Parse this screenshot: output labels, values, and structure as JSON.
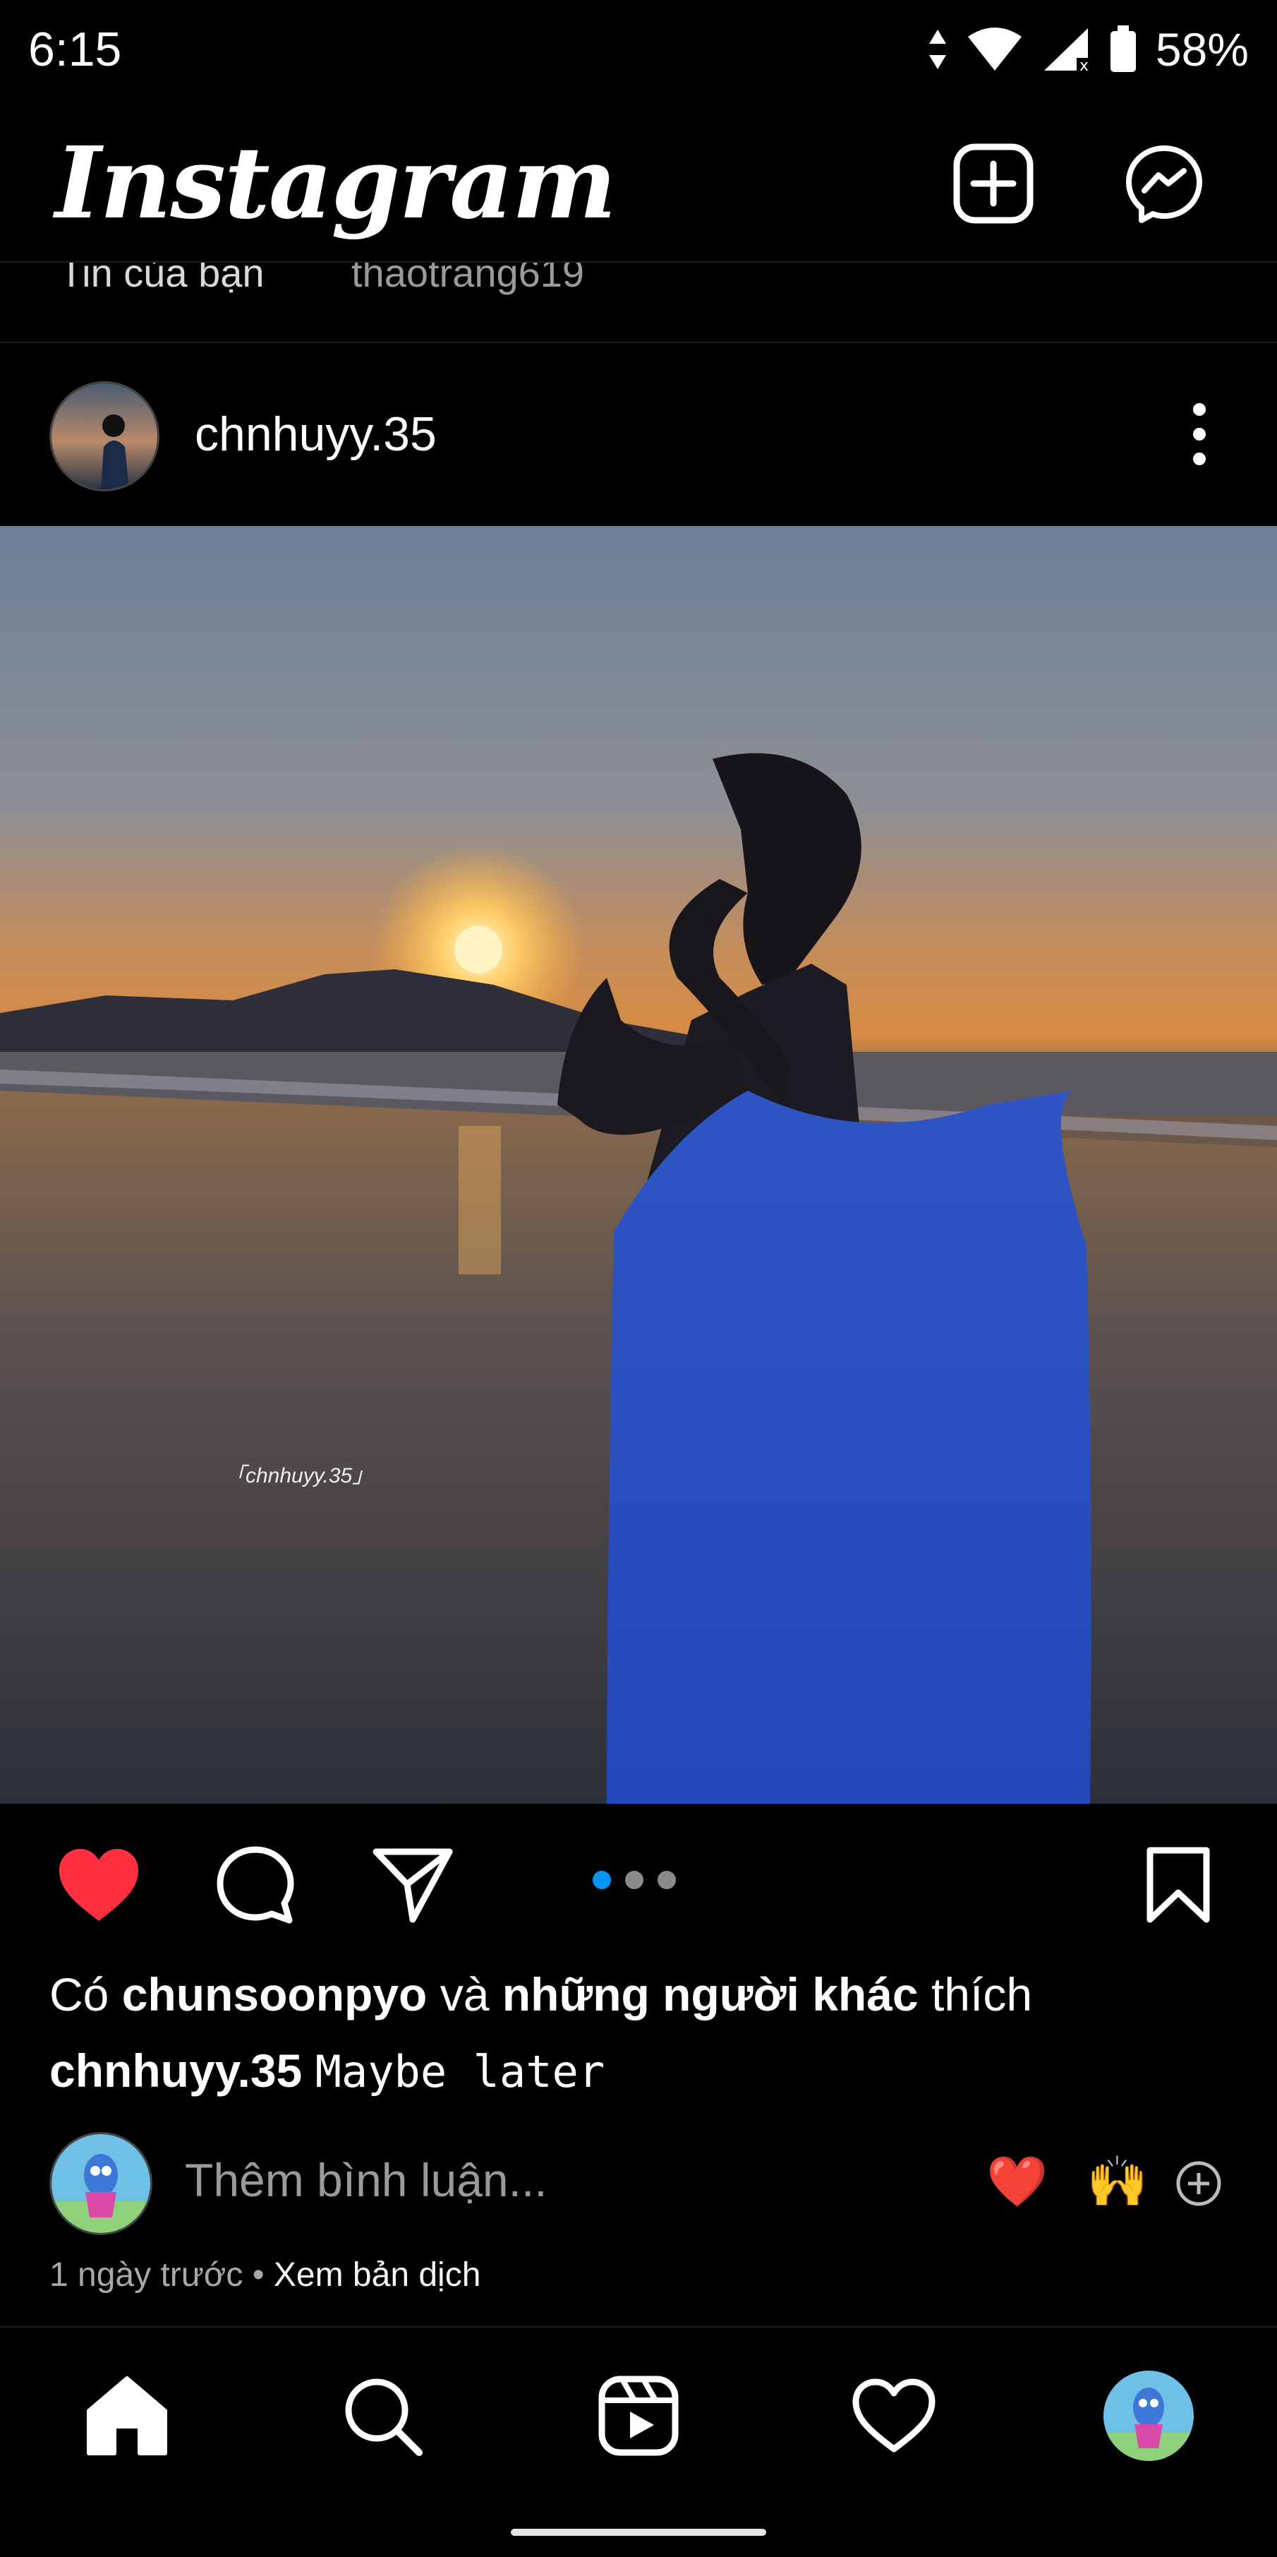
{
  "status_bar": {
    "time": "6:15",
    "battery": "58%",
    "icons": [
      "data-arrows-icon",
      "wifi-icon",
      "cell-signal-icon",
      "battery-icon"
    ]
  },
  "header": {
    "title": "Instagram",
    "new_post_icon": "plus-square-icon",
    "messenger_icon": "messenger-icon"
  },
  "stories": {
    "items": [
      {
        "label": "Tin của bạn"
      },
      {
        "label": "thaotrang619"
      }
    ]
  },
  "post": {
    "username": "chnhuyy.35",
    "watermark": "「chnhuyy.35」",
    "carousel": {
      "count": 3,
      "active_index": 0
    },
    "likes": {
      "prefix": "Có",
      "user": "chunsoonpyo",
      "middle": "và",
      "others": "những người khác",
      "suffix": "thích"
    },
    "caption": {
      "user": "chnhuyy.35",
      "text": "Maybe later"
    },
    "comment_placeholder": "Thêm bình luận...",
    "quick_reactions": [
      "❤️",
      "🙌"
    ],
    "time_ago": "1 ngày trước",
    "separator": "•",
    "translate_label": "Xem bản dịch"
  },
  "colors": {
    "background": "#000000",
    "like_red": "#ff3040",
    "accent_blue": "#0095f6",
    "muted_text": "#a8a8a8"
  },
  "bottom_nav": {
    "items": [
      "home-icon",
      "search-icon",
      "reels-icon",
      "heart-icon",
      "profile-avatar"
    ]
  }
}
